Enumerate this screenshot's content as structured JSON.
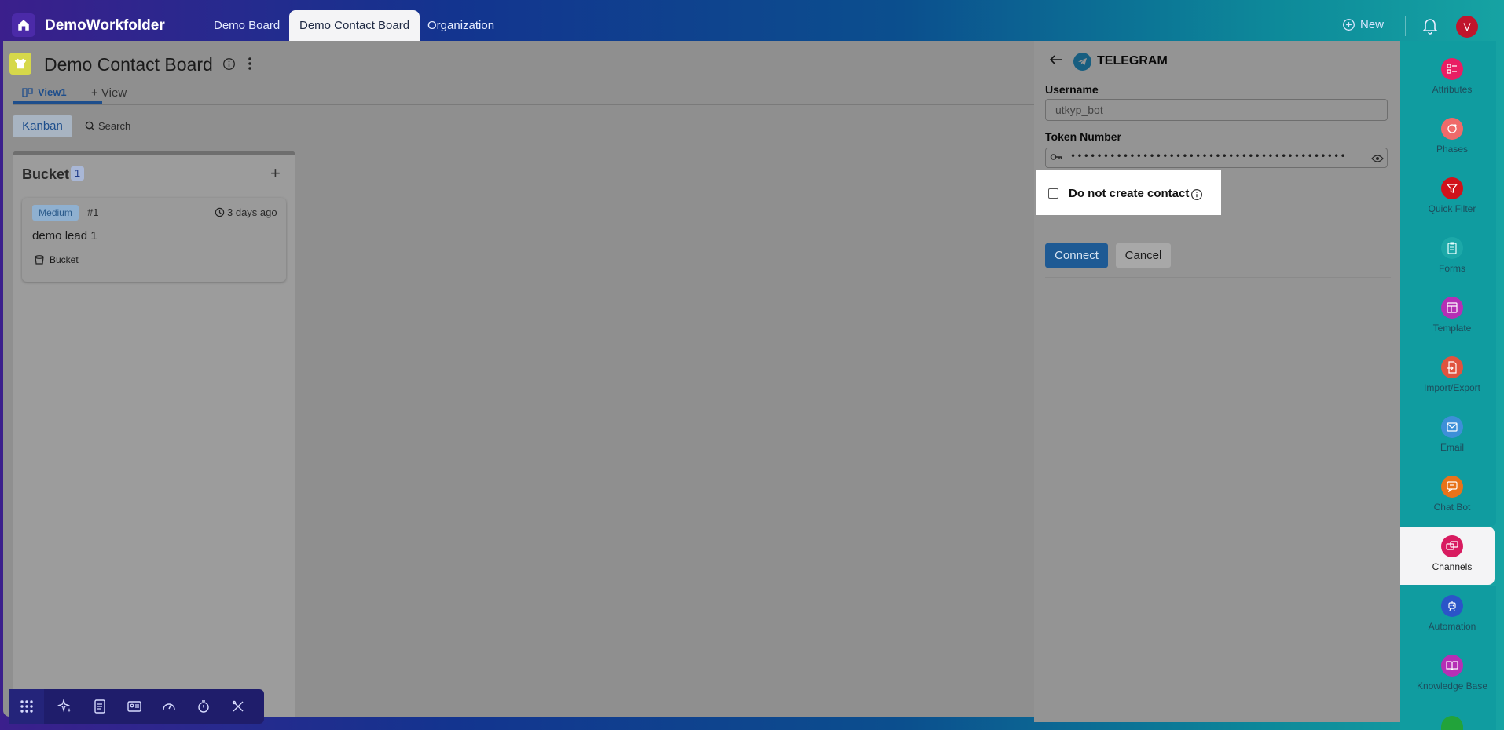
{
  "app": {
    "title": "DemoWorkfolder"
  },
  "top_tabs": [
    {
      "label": "Demo Board",
      "active": false
    },
    {
      "label": "Demo Contact Board",
      "active": true
    },
    {
      "label": "Organization",
      "active": false
    }
  ],
  "header": {
    "new_label": "New",
    "avatar_initial": "V"
  },
  "board": {
    "title": "Demo Contact Board",
    "view_tab": "View1",
    "add_view": "+ View",
    "kanban_label": "Kanban",
    "search_label": "Search",
    "columns": [
      {
        "title": "Bucket",
        "count": "1",
        "cards": [
          {
            "priority": "Medium",
            "id": "#1",
            "time": "3 days ago",
            "name": "demo lead 1",
            "bucket": "Bucket"
          }
        ]
      }
    ]
  },
  "panel": {
    "channel_title": "TELEGRAM",
    "username_label": "Username",
    "username_value": "utkyp_bot",
    "token_label": "Token Number",
    "token_masked": "••••••••••••••••••••••••••••••••••••••••••",
    "checkbox_label": "Do not create contact",
    "checkbox_checked": false,
    "connect_label": "Connect",
    "cancel_label": "Cancel"
  },
  "sidebar": {
    "items": [
      {
        "label": "Attributes",
        "icon": "attributes-icon",
        "color": "#e91e63"
      },
      {
        "label": "Phases",
        "icon": "phases-icon",
        "color": "#ef6a6a"
      },
      {
        "label": "Quick Filter",
        "icon": "filter-icon",
        "color": "#d0121b"
      },
      {
        "label": "Forms",
        "icon": "forms-icon",
        "color": "#1ca8a8"
      },
      {
        "label": "Template",
        "icon": "template-icon",
        "color": "#b52fb5"
      },
      {
        "label": "Import/Export",
        "icon": "import-export-icon",
        "color": "#e0533f"
      },
      {
        "label": "Email",
        "icon": "email-icon",
        "color": "#3d8fd8"
      },
      {
        "label": "Chat Bot",
        "icon": "chat-bot-icon",
        "color": "#e8731a"
      },
      {
        "label": "Channels",
        "icon": "channels-icon",
        "color": "#d81b60",
        "active": true
      },
      {
        "label": "Automation",
        "icon": "automation-icon",
        "color": "#2b54c8"
      },
      {
        "label": "Knowledge Base",
        "icon": "knowledge-base-icon",
        "color": "#b52fb5"
      }
    ]
  },
  "colors": {
    "accent": "#1e5a94",
    "telegram": "#2aa3dd",
    "sidebar": "#109ca0"
  }
}
